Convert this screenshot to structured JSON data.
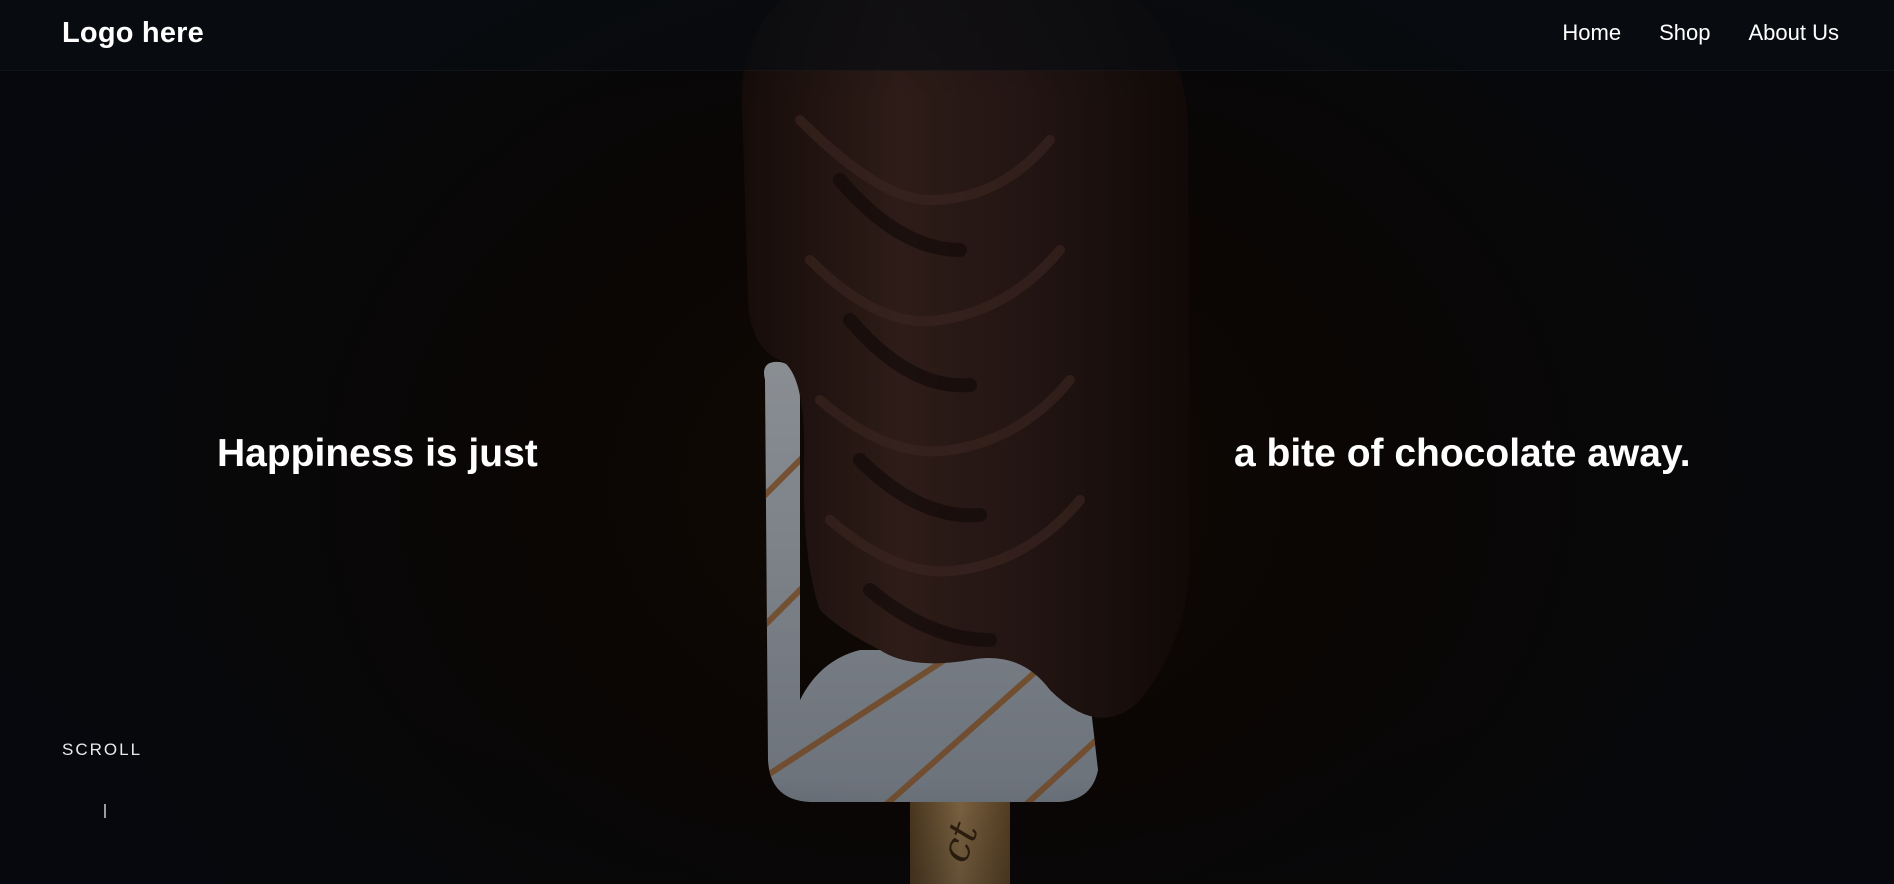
{
  "header": {
    "logo": "Logo here",
    "nav": [
      {
        "label": "Home"
      },
      {
        "label": "Shop"
      },
      {
        "label": "About Us"
      }
    ]
  },
  "hero": {
    "left_text": "Happiness is just",
    "right_text": "a bite of chocolate away.",
    "stick_text": "ct"
  },
  "scroll": {
    "label": "SCROLL"
  },
  "colors": {
    "background": "#0c0a0a",
    "chocolate": "#3a2420",
    "text": "#ffffff"
  }
}
